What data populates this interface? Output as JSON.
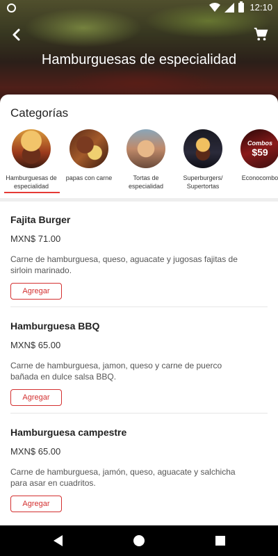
{
  "status_bar": {
    "time": "12:10"
  },
  "header": {
    "title": "Hamburguesas de especialidad"
  },
  "categories": {
    "heading": "Categorías",
    "items": [
      {
        "label": "Hamburguesas de especialidad"
      },
      {
        "label": "papas con carne"
      },
      {
        "label": "Tortas de especialidad"
      },
      {
        "label": "Superburgers/ Supertortas"
      },
      {
        "label": "Econocombo"
      }
    ],
    "selected_index": 0,
    "accent_color": "#e53935"
  },
  "products": [
    {
      "name": "Fajita Burger",
      "price": "MXN$ 71.00",
      "description": "Carne de hamburguesa, queso, aguacate y jugosas fajitas de sirloin marinado.",
      "button": "Agregar"
    },
    {
      "name": "Hamburguesa BBQ",
      "price": "MXN$ 65.00",
      "description": "Carne de hamburguesa, jamon, queso y carne de puerco bañada en dulce salsa BBQ.",
      "button": "Agregar"
    },
    {
      "name": "Hamburguesa campestre",
      "price": "MXN$ 65.00",
      "description": "Carne de hamburguesa, jamón, queso, aguacate y salchicha para asar en cuadritos.",
      "button": "Agregar"
    }
  ],
  "econocombo_badge": {
    "line1": "Combos",
    "line2": "$59"
  }
}
